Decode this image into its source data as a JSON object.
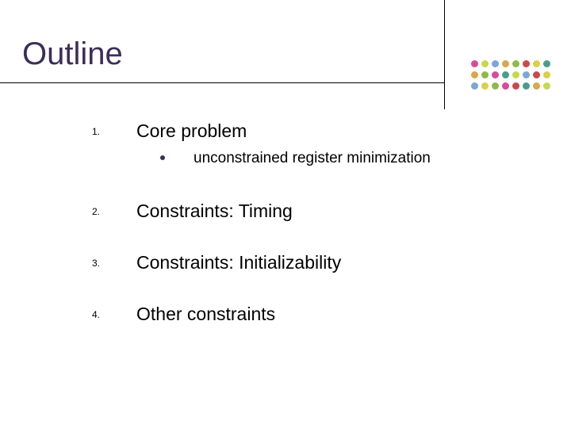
{
  "title": "Outline",
  "items": {
    "n1": "1.",
    "t1": "Core problem",
    "s1": "unconstrained register minimization",
    "n2": "2.",
    "t2": "Constraints: Timing",
    "n3": "3.",
    "t3": "Constraints: Initializability",
    "n4": "4.",
    "t4": "Other constraints"
  },
  "decor": {
    "dot_colors_row1": [
      "#d94a9c",
      "#c7d94a",
      "#7aa6d9",
      "#d9a84a",
      "#8fba4a",
      "#c94a4a",
      "#d9d04a",
      "#4a9c8f"
    ],
    "dot_colors_row2": [
      "#d9a84a",
      "#8fba4a",
      "#d94a9c",
      "#4a9c8f",
      "#c7d94a",
      "#7aa6d9",
      "#c94a4a",
      "#d9d04a"
    ],
    "dot_colors_row3": [
      "#7aa6d9",
      "#d9d04a",
      "#8fba4a",
      "#d94a9c",
      "#c94a4a",
      "#4a9c8f",
      "#d9a84a",
      "#c7d94a"
    ]
  }
}
